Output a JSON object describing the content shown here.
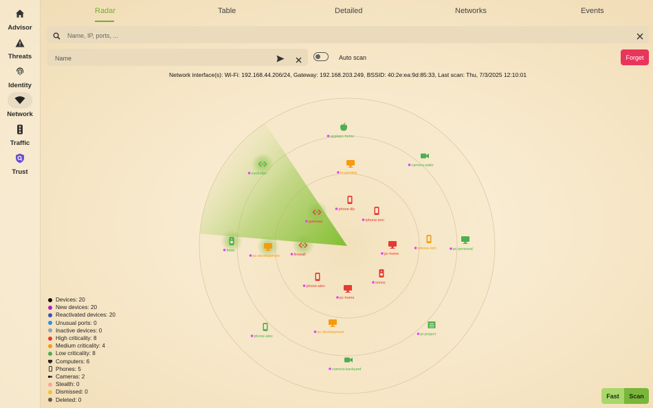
{
  "sidebar": {
    "items": [
      {
        "label": "Advisor",
        "icon": "home-icon"
      },
      {
        "label": "Threats",
        "icon": "warning-icon"
      },
      {
        "label": "Identity",
        "icon": "fingerprint-icon"
      },
      {
        "label": "Network",
        "icon": "wifi-icon",
        "active": true
      },
      {
        "label": "Traffic",
        "icon": "traffic-light-icon"
      },
      {
        "label": "Trust",
        "icon": "trust-shield-icon"
      }
    ]
  },
  "tabs": [
    "Radar",
    "Table",
    "Detailed",
    "Networks",
    "Events"
  ],
  "active_tab": "Radar",
  "search": {
    "placeholder": "Name, IP, ports, ..."
  },
  "name_field": {
    "placeholder": "Name"
  },
  "auto_scan": {
    "label": "Auto scan",
    "on": false
  },
  "forget_label": "Forget",
  "network_info": "Network interface(s): Wi-Fi: 192.168.44.206/24, Gateway: 192.168.203.249, BSSID: 40:2e:ea:9d:85:33, Last scan: Thu, 7/3/2025 12:10:01",
  "colors": {
    "accent": "#79ab2f",
    "high": "#e53935",
    "medium": "#f39c12",
    "low": "#4caf50",
    "new": "#e040fb",
    "forget": "#e8355b"
  },
  "devices": [
    {
      "label": "applepc-home",
      "icon": "apple",
      "criticality": "low"
    },
    {
      "label": "camera-patio",
      "icon": "camera",
      "criticality": "low"
    },
    {
      "label": "controller",
      "icon": "code",
      "criticality": "low"
    },
    {
      "label": "tv-gaming",
      "icon": "computer",
      "criticality": "medium"
    },
    {
      "label": "phone-lily",
      "icon": "phone",
      "criticality": "high"
    },
    {
      "label": "iphone-tom",
      "icon": "phone",
      "criticality": "high"
    },
    {
      "label": "gateway",
      "icon": "code",
      "criticality": "high"
    },
    {
      "label": "firewall",
      "icon": "code",
      "criticality": "high"
    },
    {
      "label": "pc-development",
      "icon": "computer",
      "criticality": "medium"
    },
    {
      "label": "bose",
      "icon": "speaker",
      "criticality": "low"
    },
    {
      "label": "pc-home",
      "icon": "computer",
      "criticality": "high"
    },
    {
      "label": "iphone-tom",
      "icon": "phone",
      "criticality": "medium"
    },
    {
      "label": "pc-personal",
      "icon": "computer",
      "criticality": "low"
    },
    {
      "label": "sonos",
      "icon": "speaker",
      "criticality": "high"
    },
    {
      "label": "phone-alex",
      "icon": "phone",
      "criticality": "high"
    },
    {
      "label": "pc-home",
      "icon": "computer",
      "criticality": "high"
    },
    {
      "label": "phone-alex",
      "icon": "phone",
      "criticality": "low"
    },
    {
      "label": "pc-development",
      "icon": "computer",
      "criticality": "medium"
    },
    {
      "label": "pi-project",
      "icon": "board",
      "criticality": "low"
    },
    {
      "label": "camera-backyard",
      "icon": "camera",
      "criticality": "low"
    }
  ],
  "legend": [
    {
      "label": "Devices: 20",
      "color": "#111111",
      "shape": "dot"
    },
    {
      "label": "New devices: 20",
      "color": "#b01cc7",
      "shape": "dot"
    },
    {
      "label": "Reactivated devices: 20",
      "color": "#3d4fb8",
      "shape": "dot"
    },
    {
      "label": "Unusual ports: 0",
      "color": "#2f8fe0",
      "shape": "dot"
    },
    {
      "label": "Inactive devices: 0",
      "color": "#a0a0a0",
      "shape": "dot"
    },
    {
      "label": "High criticality: 8",
      "color": "#e53935",
      "shape": "dot"
    },
    {
      "label": "Medium criticality: 4",
      "color": "#f39c12",
      "shape": "dot"
    },
    {
      "label": "Low criticality: 8",
      "color": "#4caf50",
      "shape": "dot"
    },
    {
      "label": "Computers: 6",
      "color": "#222222",
      "shape": "computer"
    },
    {
      "label": "Phones: 5",
      "color": "#222222",
      "shape": "phone"
    },
    {
      "label": "Cameras: 2",
      "color": "#222222",
      "shape": "camera"
    },
    {
      "label": "Stealth: 0",
      "color": "#f4a7a0",
      "shape": "dot"
    },
    {
      "label": "Dismissed: 0",
      "color": "#f2c230",
      "shape": "dot"
    },
    {
      "label": "Deleted: 0",
      "color": "#6b5a45",
      "shape": "dot"
    }
  ],
  "buttons": {
    "fast": "Fast",
    "scan": "Scan"
  }
}
